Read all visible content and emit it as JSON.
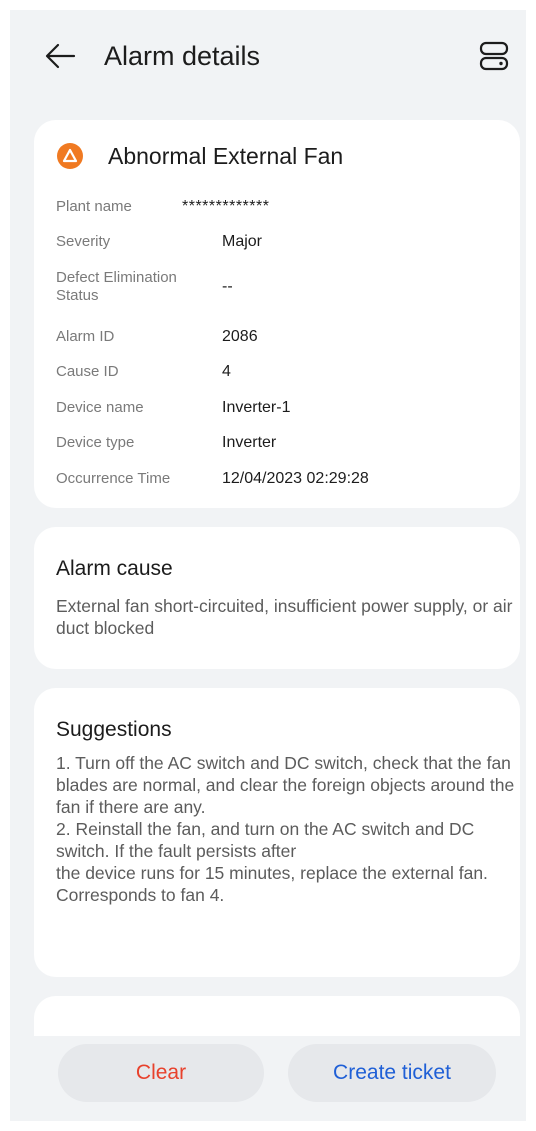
{
  "header": {
    "title": "Alarm details",
    "back_icon": "arrow-left-icon",
    "menu_icon": "stacked-panels-icon"
  },
  "alarm": {
    "name": "Abnormal External Fan",
    "severity_icon": "warning-triangle-icon",
    "severity_color": "#f07a22",
    "fields": {
      "plant_name": {
        "label": "Plant name",
        "value": "*************"
      },
      "severity": {
        "label": "Severity",
        "value": "Major"
      },
      "defect_status": {
        "label": "Defect Elimination Status",
        "value": "--"
      },
      "alarm_id": {
        "label": "Alarm ID",
        "value": "2086"
      },
      "cause_id": {
        "label": "Cause ID",
        "value": "4"
      },
      "device_name": {
        "label": "Device name",
        "value": "Inverter-1"
      },
      "device_type": {
        "label": "Device type",
        "value": "Inverter"
      },
      "occurrence_time": {
        "label": "Occurrence Time",
        "value": "12/04/2023 02:29:28"
      }
    }
  },
  "cause": {
    "title": "Alarm cause",
    "text": "External fan short-circuited, insufficient power supply, or air duct blocked"
  },
  "suggestions": {
    "title": "Suggestions",
    "text": "1. Turn off the AC switch and DC switch, check that the fan blades are normal, and clear the foreign objects around the fan if there are any.\n2. Reinstall the fan, and turn on the AC switch and DC switch. If the fault persists after\nthe device runs for 15 minutes, replace the external fan.\nCorresponds to fan 4."
  },
  "actions": {
    "clear_label": "Clear",
    "create_ticket_label": "Create ticket",
    "clear_color": "#e8412c",
    "create_ticket_color": "#1f5fd6"
  }
}
